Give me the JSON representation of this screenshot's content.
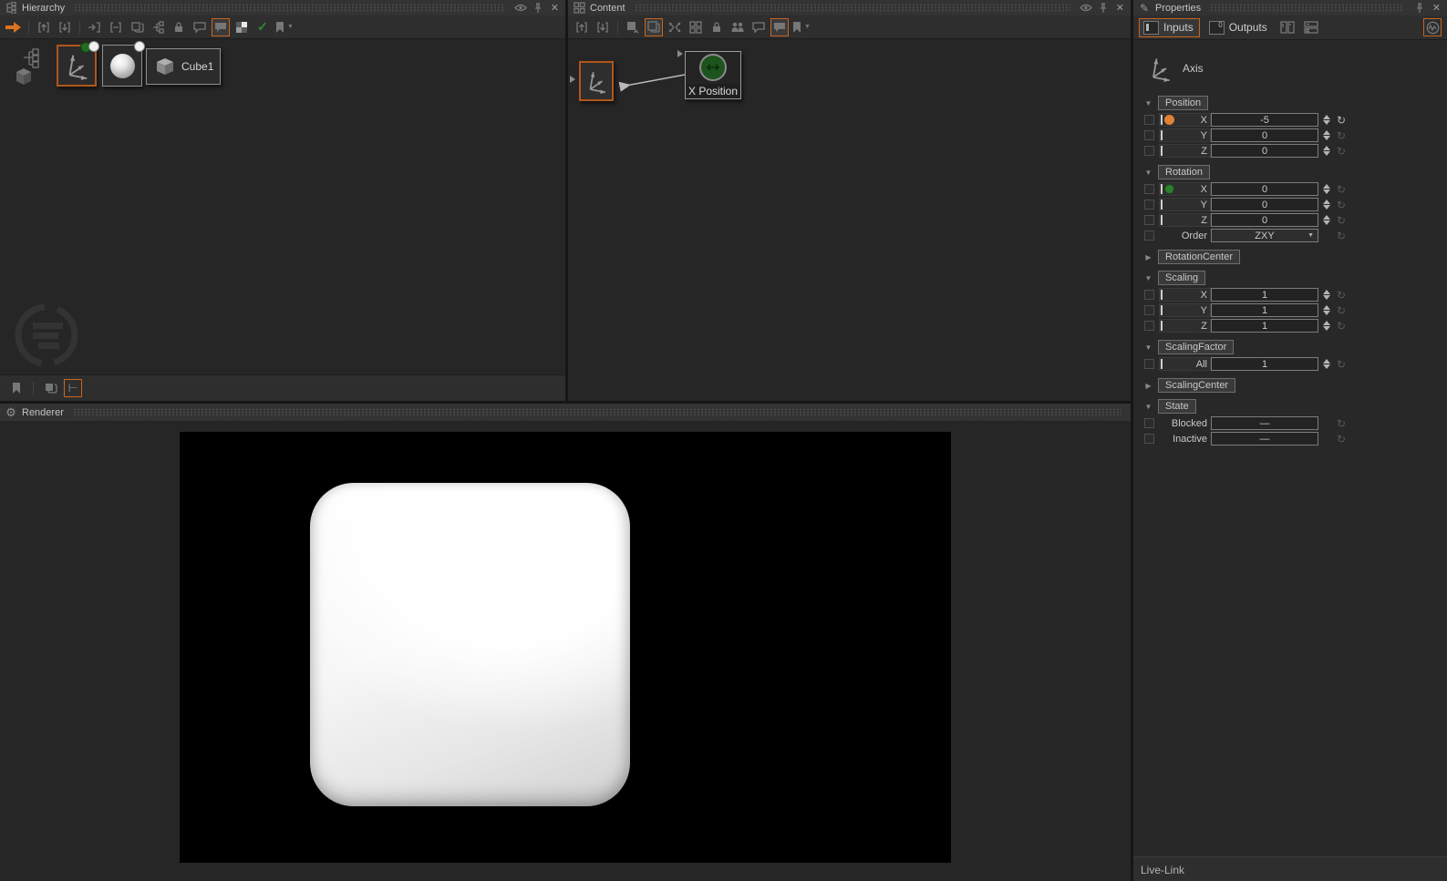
{
  "icons": {
    "close": "✕",
    "gear": "⚙",
    "pencil": "✎",
    "check": "✓",
    "reset": "↻",
    "collapse_open": "▼",
    "collapse_closed": "▶",
    "dropdown_arrow": "▼",
    "turnstile": "⊢",
    "outputs_zero": "0"
  },
  "colors": {
    "accent_orange": "#c8651f",
    "orange_binding_dot": "#e08236",
    "green_binding_dot": "#2e7d2e",
    "viewport_background": "#000000",
    "cube_color": "#f5f5f5"
  },
  "hierarchy": {
    "title": "Hierarchy",
    "cube_node_label": "Cube1"
  },
  "content": {
    "title": "Content",
    "xposition_node_label": "X Position"
  },
  "renderer": {
    "title": "Renderer"
  },
  "livelink": {
    "label": "Live-Link"
  },
  "properties": {
    "title": "Properties",
    "inputs_tab": "Inputs",
    "outputs_tab": "Outputs",
    "node_type": "Axis",
    "position": {
      "label": "Position",
      "x_label": "X",
      "x_value": "-5",
      "y_label": "Y",
      "y_value": "0",
      "z_label": "Z",
      "z_value": "0"
    },
    "rotation": {
      "label": "Rotation",
      "x_label": "X",
      "x_value": "0",
      "y_label": "Y",
      "y_value": "0",
      "z_label": "Z",
      "z_value": "0",
      "order_label": "Order",
      "order_value": "ZXY"
    },
    "rotation_center": {
      "label": "RotationCenter"
    },
    "scaling": {
      "label": "Scaling",
      "x_label": "X",
      "x_value": "1",
      "y_label": "Y",
      "y_value": "1",
      "z_label": "Z",
      "z_value": "1"
    },
    "scaling_factor": {
      "label": "ScalingFactor",
      "all_label": "All",
      "all_value": "1"
    },
    "scaling_center": {
      "label": "ScalingCenter"
    },
    "state": {
      "label": "State",
      "blocked_label": "Blocked",
      "blocked_value": "—",
      "inactive_label": "Inactive",
      "inactive_value": "—"
    }
  }
}
